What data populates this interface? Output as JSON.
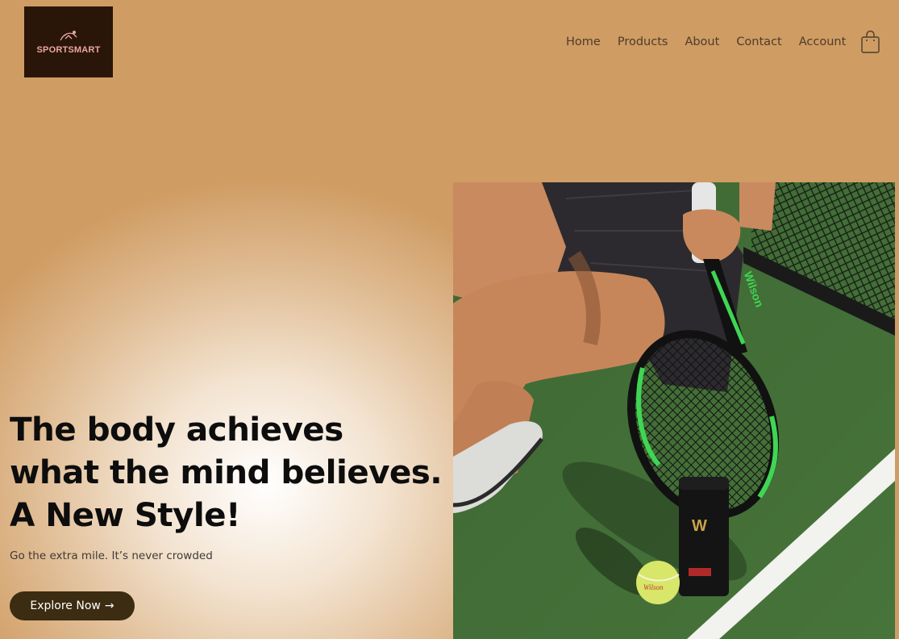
{
  "brand": {
    "logo_text": "SPORTSMART"
  },
  "nav": {
    "links": [
      "Home",
      "Products",
      "About",
      "Contact",
      "Account"
    ],
    "cart_icon": "shopping-bag-icon"
  },
  "hero": {
    "headline": [
      "The body achieves",
      "what the mind believes.",
      "A New Style!"
    ],
    "subline": "Go the extra mile. It’s never crowded",
    "cta_label": "Explore Now",
    "cta_arrow": "→",
    "image_desc": "tennis player seated on court with racket, ball and can",
    "racket_brand": "Wilson",
    "can_brand": "W",
    "ball_brand": "Wilson"
  },
  "colors": {
    "background_light": "#ffffff",
    "background_warm": "#cf9c63",
    "logo_bg": "#2a1608",
    "logo_text": "#e9a6a0",
    "nav_text": "#4d3c2c",
    "headline": "#0d0d0d",
    "cta_bg": "#3b2c12",
    "court_green": "#4a7a3d",
    "racket_green": "#3fd654"
  }
}
